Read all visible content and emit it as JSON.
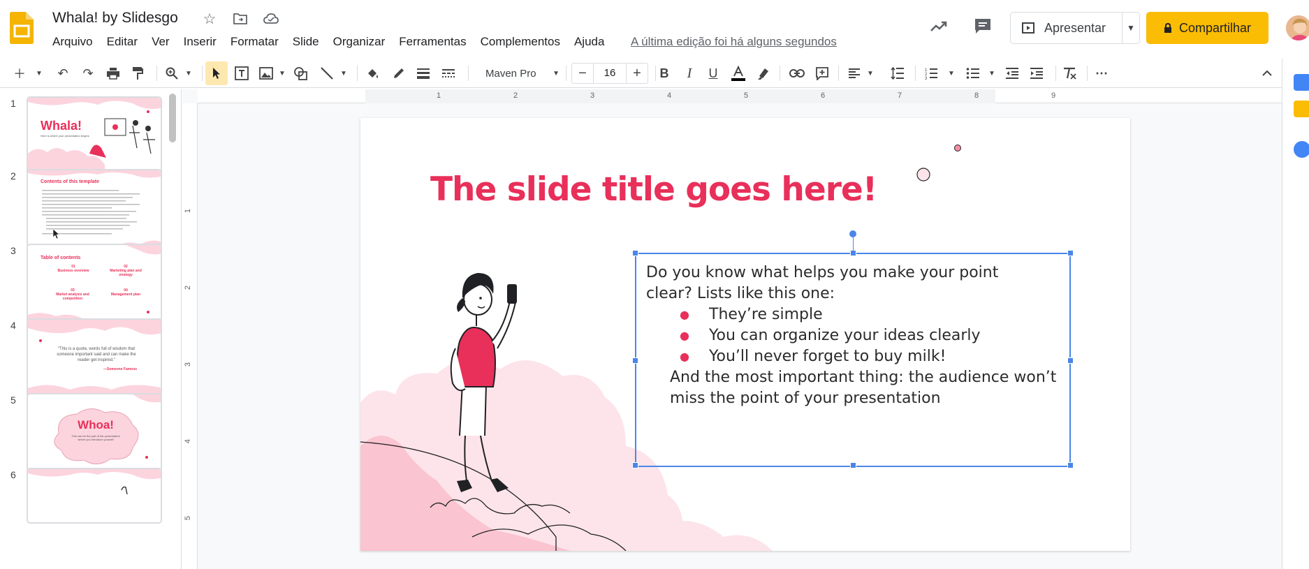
{
  "app": {
    "title": "Whala! by Slidesgo",
    "last_edit": "A última edição foi há alguns segundos"
  },
  "menu": [
    "Arquivo",
    "Editar",
    "Ver",
    "Inserir",
    "Formatar",
    "Slide",
    "Organizar",
    "Ferramentas",
    "Complementos",
    "Ajuda"
  ],
  "header": {
    "present_label": "Apresentar",
    "share_label": "Compartilhar"
  },
  "toolbar": {
    "font_name": "Maven Pro",
    "font_size": "16"
  },
  "ruler": {
    "h_ticks": [
      "1",
      "2",
      "3",
      "4",
      "5",
      "6",
      "7",
      "8",
      "9"
    ],
    "v_ticks": [
      "1",
      "2",
      "3",
      "4",
      "5"
    ]
  },
  "filmstrip": [
    {
      "num": "1",
      "title": "Whala!",
      "sub": "Here is where your presentation begins"
    },
    {
      "num": "2",
      "title": "Contents of this template",
      "sub": ""
    },
    {
      "num": "3",
      "title": "Table of contents",
      "sub": ""
    },
    {
      "num": "4",
      "title": "\"This is a quote, words full of wisdom that someone important said and can make the reader get inspired.\"",
      "sub": "—Someone Famous"
    },
    {
      "num": "5",
      "title": "Whoa!",
      "sub": "This can be the part of the presentation where you introduce yourself"
    },
    {
      "num": "6",
      "title": "",
      "sub": ""
    }
  ],
  "thumb3_items": [
    {
      "num": "01",
      "label": "Business overview"
    },
    {
      "num": "02",
      "label": "Marketing plan and strategy"
    },
    {
      "num": "03",
      "label": "Market analysis and competition"
    },
    {
      "num": "04",
      "label": "Management plan"
    }
  ],
  "slide": {
    "title": "The slide title goes here!",
    "intro_line1": "Do you know what helps you make your point",
    "intro_line2": "clear? Lists like this one:",
    "bullets": [
      "They’re simple",
      "You can organize your ideas clearly",
      "You’ll never forget to buy milk!"
    ],
    "outro_line1": "And the most important thing: the audience won’t",
    "outro_line2": "miss the point of your presentation"
  },
  "colors": {
    "accent": "#e8305a",
    "share": "#fbbc04",
    "selection": "#4a86e8",
    "cloud": "#fcd4de"
  }
}
